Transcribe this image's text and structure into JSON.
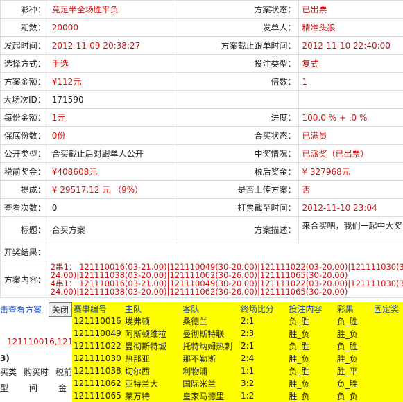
{
  "rows": [
    {
      "l1": "彩种：",
      "v1": "竞足半全场胜平负",
      "l2": "方案状态：",
      "v2": "已出票"
    },
    {
      "l1": "期数：",
      "v1": "20000",
      "l2": "发单人：",
      "v2": "精准头狼"
    },
    {
      "l1": "发起时间：",
      "v1": "2012-11-09 20:38:27",
      "l2": "方案截止跟单时间：",
      "v2": "2012-11-10 22:40:00"
    },
    {
      "l1": "选择方式：",
      "v1": "手选",
      "l2": "投注类型：",
      "v2": "复式"
    },
    {
      "l1": "方案金额：",
      "v1": "¥112元",
      "l2": "倍数：",
      "v2": "1"
    },
    {
      "l1": "大场次ID：",
      "v1": "171590",
      "l2": "",
      "v2": ""
    },
    {
      "l1": "每份金额：",
      "v1": "1元",
      "l2": "进度：",
      "v2": "100.0 % + .0 %"
    },
    {
      "l1": "保底份数：",
      "v1": "0份",
      "l2": "合买状态：",
      "v2": "已满员"
    },
    {
      "l1": "公开类型：",
      "v1": "合买截止后对跟单人公开",
      "l2": "中奖情况：",
      "v2": "已派奖（已出票）"
    },
    {
      "l1": "税前奖金：",
      "v1": "¥408608元",
      "l2": "税后奖金：",
      "v2": "¥ 327968元"
    },
    {
      "l1": "提成：",
      "v1": "¥ 29517.12 元 （9%）",
      "l2": "是否上传方案：",
      "v2": "否"
    },
    {
      "l1": "查看次数：",
      "v1": "0",
      "l2": "打票截至时间：",
      "v2": "2012-11-10 23:04"
    }
  ],
  "title_row": {
    "l1": "标题：",
    "v1": "合买方案",
    "l2": "方案描述：",
    "v2": "来合买吧，我们一起中大奖!"
  },
  "kj": {
    "label": "开奖结果："
  },
  "fanan": {
    "label": "方案内容：",
    "lines": [
      "2串1： 121110016(03-21.00)|121110049(30-20.00)|121111022(03-20.00)|121111030(30-",
      "24.00)|121111038(03-20.00)|121111062(30-26.00)|121111065(30-20.00)",
      "4串1： 121110016(03-21.00)|121110049(30-20.00)|121111022(03-20.00)|121111030(30-",
      "24.00)|121111038(03-20.00)|121111062(30-26.00)|121111065(30-20.00)"
    ]
  },
  "view_link": "击查看方案",
  "close_btn": "关闭",
  "bottom_ids": "121110016,1211",
  "bottom_b": "3)",
  "bottom_headers": [
    "买类",
    "购买时",
    "税前"
  ],
  "bottom_sub": [
    "型",
    "间",
    "金"
  ],
  "popup": {
    "headers": [
      "赛事编号",
      "主队",
      "客队",
      "终场比分",
      "投注内容",
      "彩果",
      "固定奖"
    ],
    "rows": [
      [
        "121110016",
        "埃弗顿",
        "桑德兰",
        "2:1",
        "负_胜",
        "负_胜",
        ""
      ],
      [
        "121110049",
        "阿斯顿维拉",
        "曼彻斯特联",
        "2:3",
        "胜_负",
        "胜_负",
        ""
      ],
      [
        "121111022",
        "曼彻斯特城",
        "托特纳姆热刺",
        "2:1",
        "负_胜",
        "负_胜",
        ""
      ],
      [
        "121111030",
        "热那亚",
        "那不勒斯",
        "2:4",
        "胜_负",
        "胜_负",
        ""
      ],
      [
        "121111038",
        "切尔西",
        "利物浦",
        "1:1",
        "负_胜",
        "胜_平",
        ""
      ],
      [
        "121111062",
        "亚特兰大",
        "国际米兰",
        "3:2",
        "胜_负",
        "负_胜",
        ""
      ],
      [
        "121111065",
        "莱万特",
        "皇家马德里",
        "1:2",
        "胜_负",
        "负_负",
        ""
      ]
    ]
  }
}
